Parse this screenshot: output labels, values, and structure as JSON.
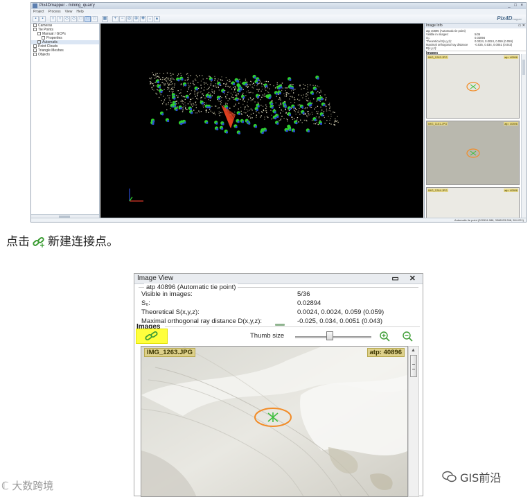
{
  "screenshot": {
    "window_title": "Pix4Dmapper - mining_quarry",
    "window_controls": "_ □ ×",
    "menu": [
      "Project",
      "Process",
      "View",
      "Help"
    ],
    "logo": "Pix4D",
    "logo_sub": "mapper",
    "tree": [
      {
        "label": "Cameras",
        "indent": 0,
        "selected": false
      },
      {
        "label": "Tie Points",
        "indent": 0,
        "selected": false
      },
      {
        "label": "Manual / GCPs",
        "indent": 1,
        "selected": false
      },
      {
        "label": "Properties",
        "indent": 2,
        "selected": false
      },
      {
        "label": "Automatic",
        "indent": 1,
        "selected": true
      },
      {
        "label": "Point Clouds",
        "indent": 0,
        "selected": false
      },
      {
        "label": "Triangle Meshes",
        "indent": 0,
        "selected": false
      },
      {
        "label": "Objects",
        "indent": 0,
        "selected": false
      }
    ],
    "right_panel": {
      "title": "Image Info",
      "info_rows": [
        {
          "k": "atp 40896 (Automatic tie point)",
          "v": ""
        },
        {
          "k": "Visible in images:",
          "v": "5/36"
        },
        {
          "k": "S₀:",
          "v": "0.02894"
        },
        {
          "k": "Theoretical S(x,y,z):",
          "v": "0.0024, 0.0024, 0.059 (0.059)"
        },
        {
          "k": "Maximal orthogonal ray distance D(x,y,z):",
          "v": "-0.025, 0.034, 0.0051 (0.043)"
        }
      ],
      "images_label": "Images",
      "thumb_size_label": "Thumb size",
      "thumbs": [
        {
          "name": "IMG_1263.JPG",
          "atp": "atp: 40896"
        },
        {
          "name": "IMG_1101.JPG",
          "atp": "atp: 40896"
        },
        {
          "name": "IMG_1264.JPG",
          "atp": "atp: 40896"
        }
      ]
    },
    "status_text": "Automatic tie point (322634.988, 3368933.288, 594.221)"
  },
  "caption": {
    "before": "点击",
    "after": "新建连接点。"
  },
  "image_view": {
    "title": "Image View",
    "controls": "▭ ✕",
    "point_title": "atp 40896 (Automatic tie point)",
    "rows": [
      {
        "label": "Visible in images:",
        "value": "5/36"
      },
      {
        "label": "S₀:",
        "value": "0.02894"
      },
      {
        "label": "Theoretical S(x,y,z):",
        "value": "0.0024, 0.0024, 0.059 (0.059)"
      },
      {
        "label": "Maximal orthogonal ray distance D(x,y,z):",
        "value": "-0.025, 0.034, 0.0051 (0.043)"
      }
    ],
    "images_label": "Images",
    "thumb_size_label": "Thumb size",
    "thumb_size_level": 0.45,
    "image_name": "IMG_1263.JPG",
    "atp_label": "atp: 40896",
    "highlight_color": "#ffff3d",
    "marker_color": "#f28c28",
    "cross_color": "#3fbf3f"
  },
  "watermarks": {
    "left": "大数跨境",
    "right": "GIS前沿"
  }
}
